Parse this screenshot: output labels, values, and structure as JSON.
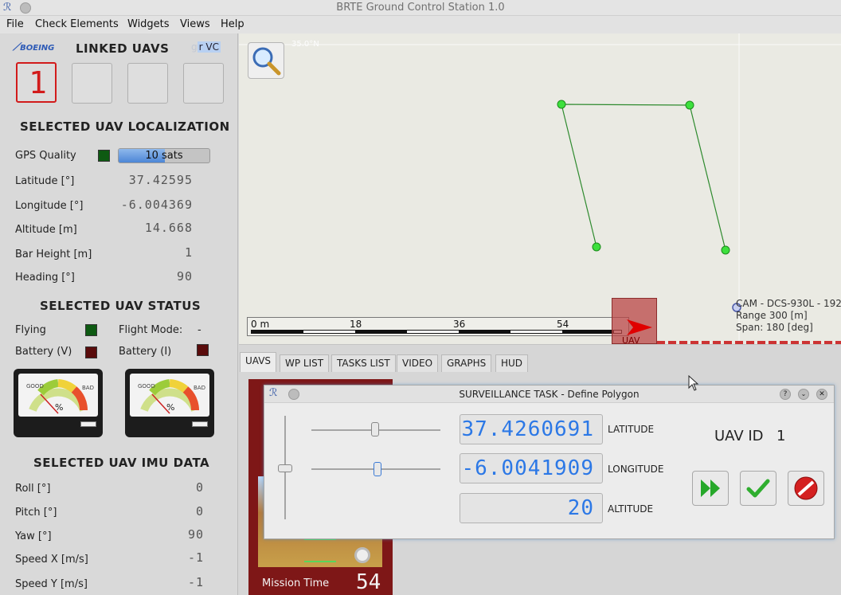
{
  "window": {
    "title": "BRTE Ground Control Station 1.0"
  },
  "menu": [
    "File",
    "Check Elements",
    "Widgets",
    "Views",
    "Help"
  ],
  "left": {
    "brand_left": "BOEING",
    "brand_right": "r VC",
    "linked_title": "LINKED UAVS",
    "linked_uav_digit": "1",
    "localization": {
      "title": "SELECTED UAV LOCALIZATION",
      "gps_label": "GPS Quality",
      "gps_sats": "10 sats",
      "gps_color": "#0e5a12",
      "rows": [
        {
          "label": "Latitude [°]",
          "value": "37.42595"
        },
        {
          "label": "Longitude [°]",
          "value": "-6.004369"
        },
        {
          "label": "Altitude [m]",
          "value": "14.668"
        },
        {
          "label": "Bar Height [m]",
          "value": "1"
        },
        {
          "label": "Heading [°]",
          "value": "90"
        }
      ]
    },
    "status": {
      "title": "SELECTED UAV STATUS",
      "flying_label": "Flying",
      "flying_color": "#0e5a12",
      "flight_mode_label": "Flight Mode:",
      "flight_mode_value": "-",
      "battery_v_label": "Battery  (V)",
      "battery_i_label": "Battery  (I)",
      "battery_color": "#5a0c0c",
      "gauge_good": "GOOD",
      "gauge_bad": "BAD",
      "gauge_unit": "%"
    },
    "imu": {
      "title": "SELECTED UAV IMU DATA",
      "rows": [
        {
          "label": "Roll [°]",
          "value": "0"
        },
        {
          "label": "Pitch [°]",
          "value": "0"
        },
        {
          "label": "Yaw [°]",
          "value": "90"
        },
        {
          "label": "Speed X [m/s]",
          "value": "-1"
        },
        {
          "label": "Speed Y [m/s]",
          "value": "-1"
        }
      ]
    }
  },
  "map": {
    "lat_tag": "35.0°N",
    "scale_labels": [
      "0 m",
      "18",
      "36",
      "54"
    ],
    "uav_label": "UAV",
    "camera_lines": [
      "CAM - DCS-930L - 192",
      "Range 300 [m]",
      "Span: 180 [deg]"
    ]
  },
  "tabs": [
    "UAVS",
    "WP LIST",
    "TASKS LIST",
    "VIDEO",
    "GRAPHS",
    "HUD"
  ],
  "uav_panel": {
    "mission_label": "Mission Time",
    "mission_value": "54"
  },
  "dialog": {
    "title": "SURVEILLANCE TASK - Define Polygon",
    "latitude_value": "37.4260691",
    "latitude_label": "LATITUDE",
    "longitude_value": "-6.0041909",
    "longitude_label": "LONGITUDE",
    "altitude_value": "20",
    "altitude_label": "ALTITUDE",
    "uav_id_label": "UAV ID",
    "uav_id_value": "1"
  }
}
